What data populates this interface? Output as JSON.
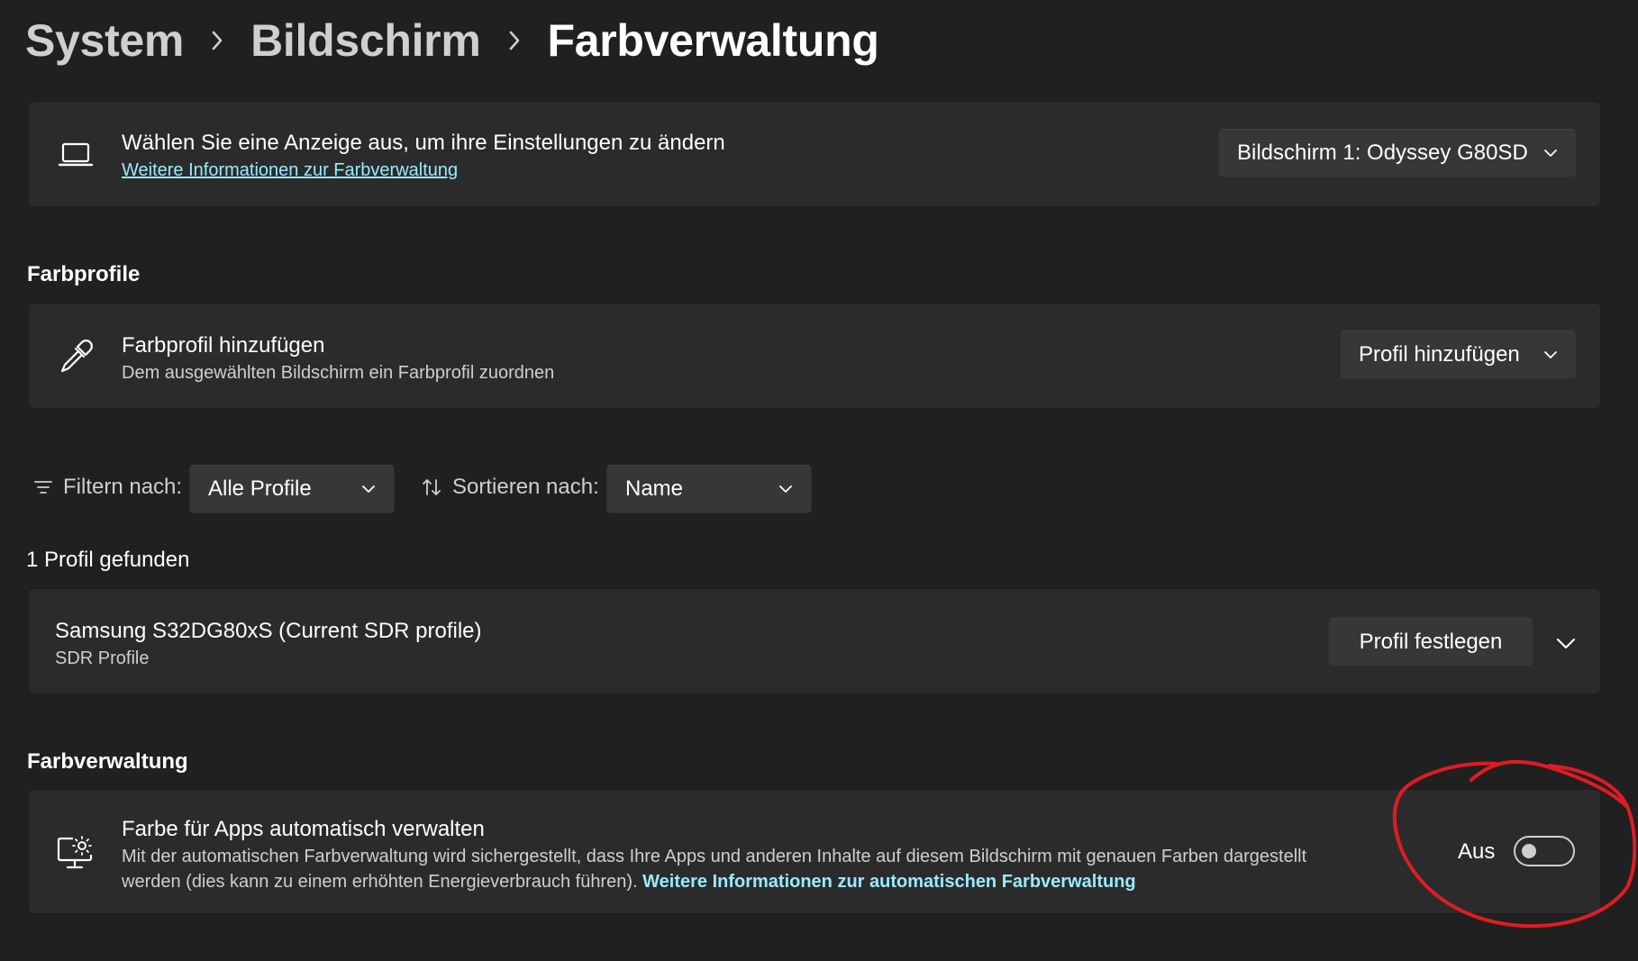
{
  "breadcrumb": {
    "items": [
      "System",
      "Bildschirm",
      "Farbverwaltung"
    ]
  },
  "display_select": {
    "title": "Wählen Sie eine Anzeige aus, um ihre Einstellungen zu ändern",
    "link": "Weitere Informationen zur Farbverwaltung",
    "icon": "laptop-icon",
    "selected": "Bildschirm 1: Odyssey G80SD"
  },
  "color_profiles": {
    "header": "Farbprofile",
    "add": {
      "title": "Farbprofil hinzufügen",
      "subtitle": "Dem ausgewählten Bildschirm ein Farbprofil zuordnen",
      "icon": "eyedropper-icon",
      "button": "Profil hinzufügen"
    }
  },
  "filter": {
    "icon": "filter-icon",
    "label": "Filtern nach:",
    "selected": "Alle Profile"
  },
  "sort": {
    "icon": "sort-icon",
    "label": "Sortieren nach:",
    "selected": "Name"
  },
  "results": {
    "count": "1 Profil gefunden",
    "profiles": [
      {
        "name": "Samsung S32DG80xS (Current SDR profile)",
        "type": "SDR Profile",
        "button": "Profil festlegen"
      }
    ]
  },
  "color_management": {
    "header": "Farbverwaltung",
    "auto": {
      "icon": "display-brightness-icon",
      "title": "Farbe für Apps automatisch verwalten",
      "description_line1": "Mit der automatischen Farbverwaltung wird sichergestellt, dass Ihre Apps und anderen Inhalte auf diesem Bildschirm mit genauen Farben dargestellt",
      "description_line2": "werden (dies kann zu einem erhöhten Energieverbrauch führen).",
      "link": "Weitere Informationen zur automatischen Farbverwaltung",
      "toggle_label": "Aus",
      "toggle_on": false
    }
  },
  "colors": {
    "background": "#202020",
    "card": "#2b2b2b",
    "link": "#99ebff",
    "annotation": "#e01b24"
  }
}
